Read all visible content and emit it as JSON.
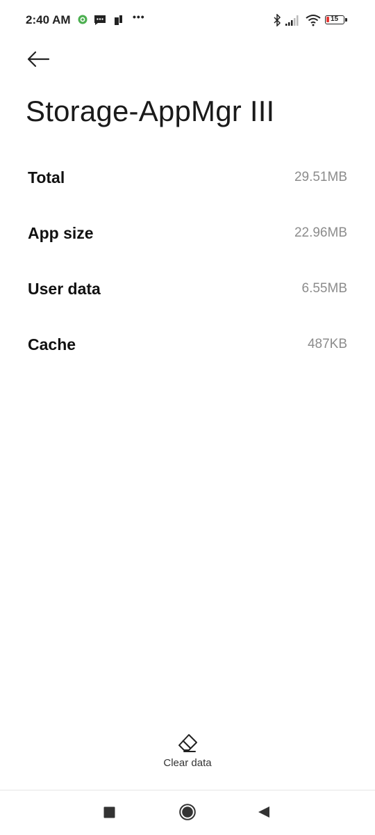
{
  "status_bar": {
    "time": "2:40 AM",
    "more_notifications": "•••",
    "battery_level": "15"
  },
  "header": {
    "title": "Storage-AppMgr III"
  },
  "storage": {
    "rows": [
      {
        "label": "Total",
        "value": "29.51MB"
      },
      {
        "label": "App size",
        "value": "22.96MB"
      },
      {
        "label": "User data",
        "value": "6.55MB"
      },
      {
        "label": "Cache",
        "value": "487KB"
      }
    ]
  },
  "actions": {
    "clear_data_label": "Clear data"
  },
  "colors": {
    "battery_low": "#e53935",
    "notif_green": "#4caf50",
    "value_gray": "#8c8c8c"
  }
}
